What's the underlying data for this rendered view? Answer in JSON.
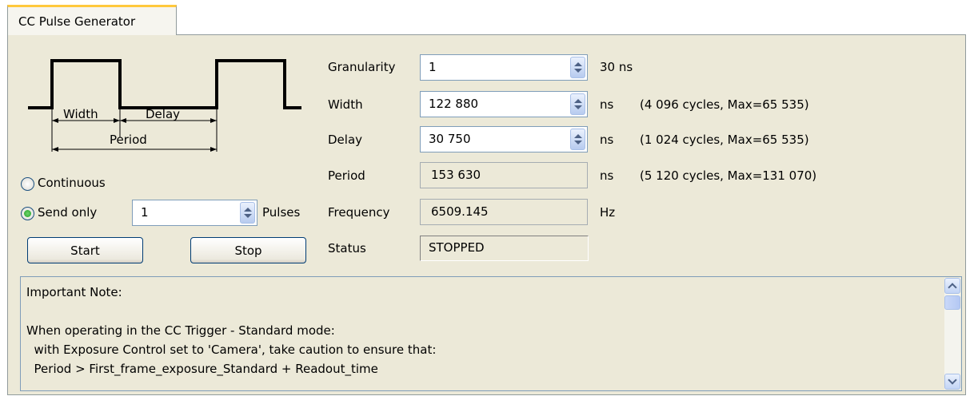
{
  "tab": {
    "label": "CC Pulse Generator"
  },
  "diagram": {
    "width_label": "Width",
    "delay_label": "Delay",
    "period_label": "Period"
  },
  "mode": {
    "continuous_label": "Continuous",
    "send_only_label": "Send only",
    "selected": "send_only",
    "pulses_value": "1",
    "pulses_unit": "Pulses"
  },
  "buttons": {
    "start": "Start",
    "stop": "Stop"
  },
  "params": {
    "granularity": {
      "label": "Granularity",
      "value": "1",
      "unit": "30  ns",
      "info": ""
    },
    "width": {
      "label": "Width",
      "value": "122 880",
      "unit": "ns",
      "info": "(4 096 cycles, Max=65 535)"
    },
    "delay": {
      "label": "Delay",
      "value": "30 750",
      "unit": "ns",
      "info": "(1 024 cycles, Max=65 535)"
    },
    "period": {
      "label": "Period",
      "value": "153 630",
      "unit": "ns",
      "info": "(5 120 cycles, Max=131 070)"
    },
    "frequency": {
      "label": "Frequency",
      "value": "6509.145",
      "unit": "Hz"
    },
    "status": {
      "label": "Status",
      "value": "STOPPED"
    }
  },
  "notes": {
    "lines": [
      "Important Note:",
      "",
      "When operating in the CC Trigger - Standard mode:",
      "  with Exposure Control set to 'Camera', take caution to ensure that:",
      "  Period > First_frame_exposure_Standard + Readout_time"
    ]
  }
}
